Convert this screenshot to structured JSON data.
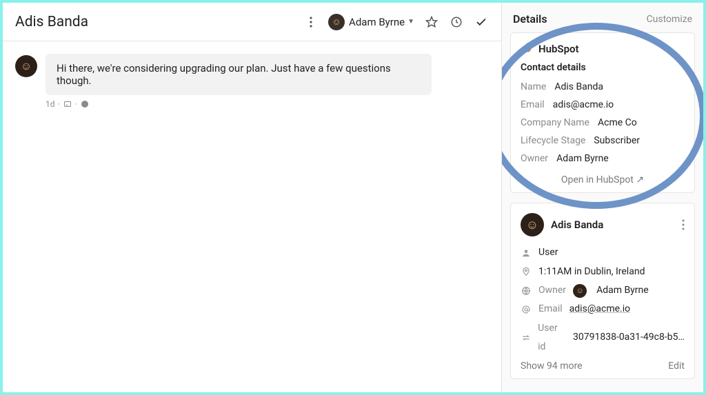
{
  "header": {
    "title": "Adis Banda",
    "assignee_name": "Adam Byrne"
  },
  "thread": {
    "messages": [
      {
        "body": "Hi there, we're considering upgrading our plan. Just have a few questions though.",
        "age": "1d"
      }
    ]
  },
  "details": {
    "title": "Details",
    "customize_label": "Customize"
  },
  "hubspot_card": {
    "brand": "HubSpot",
    "section_title": "Contact details",
    "fields": {
      "name_label": "Name",
      "name_value": "Adis Banda",
      "email_label": "Email",
      "email_value": "adis@acme.io",
      "company_label": "Company Name",
      "company_value": "Acme Co",
      "lifecycle_label": "Lifecycle Stage",
      "lifecycle_value": "Subscriber",
      "owner_label": "Owner",
      "owner_value": "Adam Byrne"
    },
    "open_label": "Open in HubSpot ↗"
  },
  "profile_card": {
    "name": "Adis Banda",
    "role": "User",
    "local_time": "1:11AM in Dublin, Ireland",
    "owner_label": "Owner",
    "owner_value": "Adam Byrne",
    "email_label": "Email",
    "email_value": "adis@acme.io",
    "userid_label": "User id",
    "userid_value": "30791838-0a31-49c8-b58...",
    "show_more": "Show 94 more",
    "edit": "Edit"
  }
}
